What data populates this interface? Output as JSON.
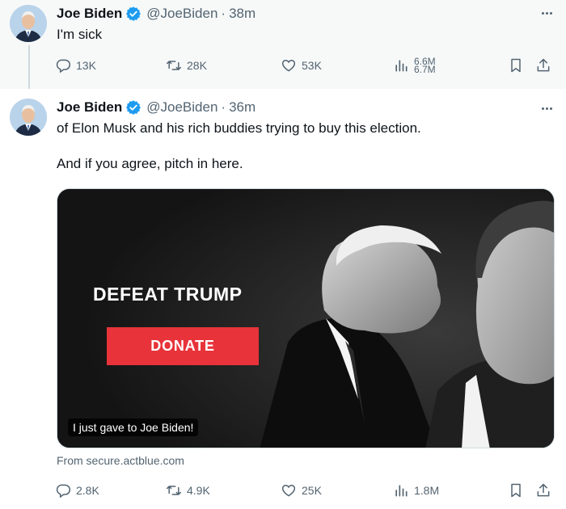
{
  "tweets": [
    {
      "name": "Joe Biden",
      "handle": "@JoeBiden",
      "separator": "·",
      "time": "38m",
      "text": "I'm sick",
      "stats": {
        "replies": "13K",
        "retweets": "28K",
        "likes": "53K",
        "views_top": "6.6M",
        "views_bottom": "6.7M"
      }
    },
    {
      "name": "Joe Biden",
      "handle": "@JoeBiden",
      "separator": "·",
      "time": "36m",
      "text": "of Elon Musk and his rich buddies trying to buy this election.\n\nAnd if you agree, pitch in here.",
      "media": {
        "headline": "DEFEAT TRUMP",
        "button_label": "DONATE",
        "caption": "I just gave to Joe Biden!",
        "source": "From secure.actblue.com"
      },
      "stats": {
        "replies": "2.8K",
        "retweets": "4.9K",
        "likes": "25K",
        "views": "1.8M"
      }
    }
  ],
  "icons": {
    "verified": "verified-badge-icon",
    "more": "more-icon",
    "reply": "reply-icon",
    "retweet": "retweet-icon",
    "like": "heart-icon",
    "views": "views-chart-icon",
    "bookmark": "bookmark-icon",
    "share": "share-icon"
  },
  "colors": {
    "verified": "#1d9bf0",
    "text_secondary": "#536471",
    "donate_button": "#e8333a"
  }
}
